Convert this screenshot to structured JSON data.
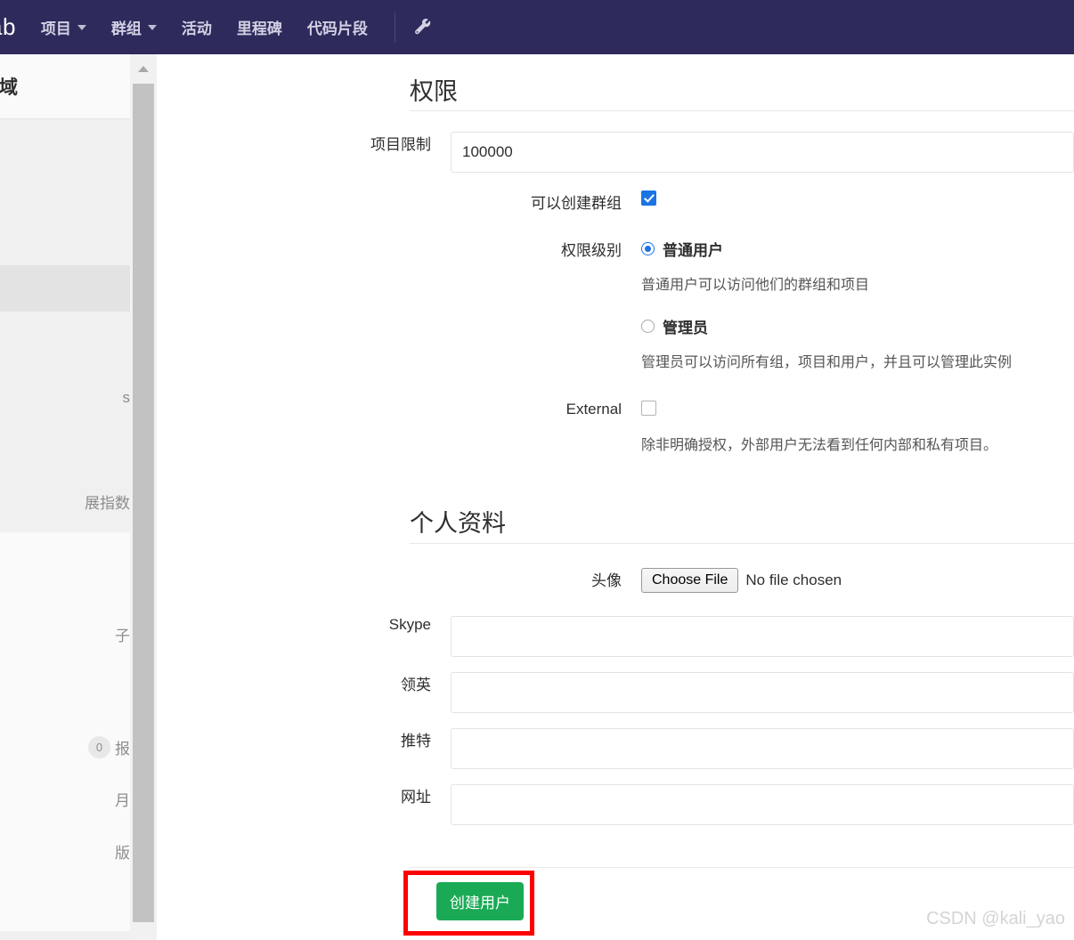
{
  "navbar": {
    "brand": "ab",
    "items": [
      {
        "label": "项目",
        "caret": true,
        "name": "nav-item-projects"
      },
      {
        "label": "群组",
        "caret": true,
        "name": "nav-item-groups"
      },
      {
        "label": "活动",
        "caret": false,
        "name": "nav-item-activity"
      },
      {
        "label": "里程碑",
        "caret": false,
        "name": "nav-item-milestones"
      },
      {
        "label": "代码片段",
        "caret": false,
        "name": "nav-item-snippets"
      }
    ],
    "admin_icon": "wrench-icon"
  },
  "sidebar": {
    "header": "区域",
    "items": [
      {
        "label": "",
        "name": "sidebar-item-1"
      },
      {
        "label": "",
        "name": "sidebar-item-2"
      },
      {
        "label": "",
        "name": "sidebar-item-3"
      },
      {
        "label": "s",
        "name": "sidebar-item-4"
      },
      {
        "label": "展指数",
        "name": "sidebar-item-5"
      },
      {
        "label": "子",
        "name": "sidebar-item-6"
      },
      {
        "label": "报",
        "badge": "0",
        "name": "sidebar-item-7"
      },
      {
        "label": "月",
        "name": "sidebar-item-8"
      },
      {
        "label": "版",
        "name": "sidebar-item-9"
      }
    ]
  },
  "scrollbar": {
    "arrow_up": "scroll-up-arrow"
  },
  "permissions": {
    "title": "权限",
    "project_limit": {
      "label": "项目限制",
      "value": "100000"
    },
    "can_create_group": {
      "label": "可以创建群组",
      "checked": true
    },
    "access_level": {
      "label": "权限级别",
      "options": [
        {
          "label": "普通用户",
          "selected": true,
          "description": "普通用户可以访问他们的群组和项目"
        },
        {
          "label": "管理员",
          "selected": false,
          "description": "管理员可以访问所有组，项目和用户，并且可以管理此实例"
        }
      ]
    },
    "external": {
      "label": "External",
      "checked": false,
      "description": "除非明确授权，外部用户无法看到任何内部和私有项目。"
    }
  },
  "profile": {
    "title": "个人资料",
    "avatar": {
      "label": "头像",
      "button_label": "Choose File",
      "status": "No file chosen"
    },
    "fields": [
      {
        "label": "Skype",
        "value": "",
        "name": "skype-field"
      },
      {
        "label": "领英",
        "value": "",
        "name": "linkedin-field"
      },
      {
        "label": "推特",
        "value": "",
        "name": "twitter-field"
      },
      {
        "label": "网址",
        "value": "",
        "name": "website-field"
      }
    ]
  },
  "actions": {
    "create_user": "创建用户"
  },
  "watermark": "CSDN @kali_yao",
  "colors": {
    "navbar": "#2e2a5b",
    "primary_button": "#1aaa55",
    "checkbox_accent": "#1b74e4",
    "annotation": "#ff0000"
  }
}
